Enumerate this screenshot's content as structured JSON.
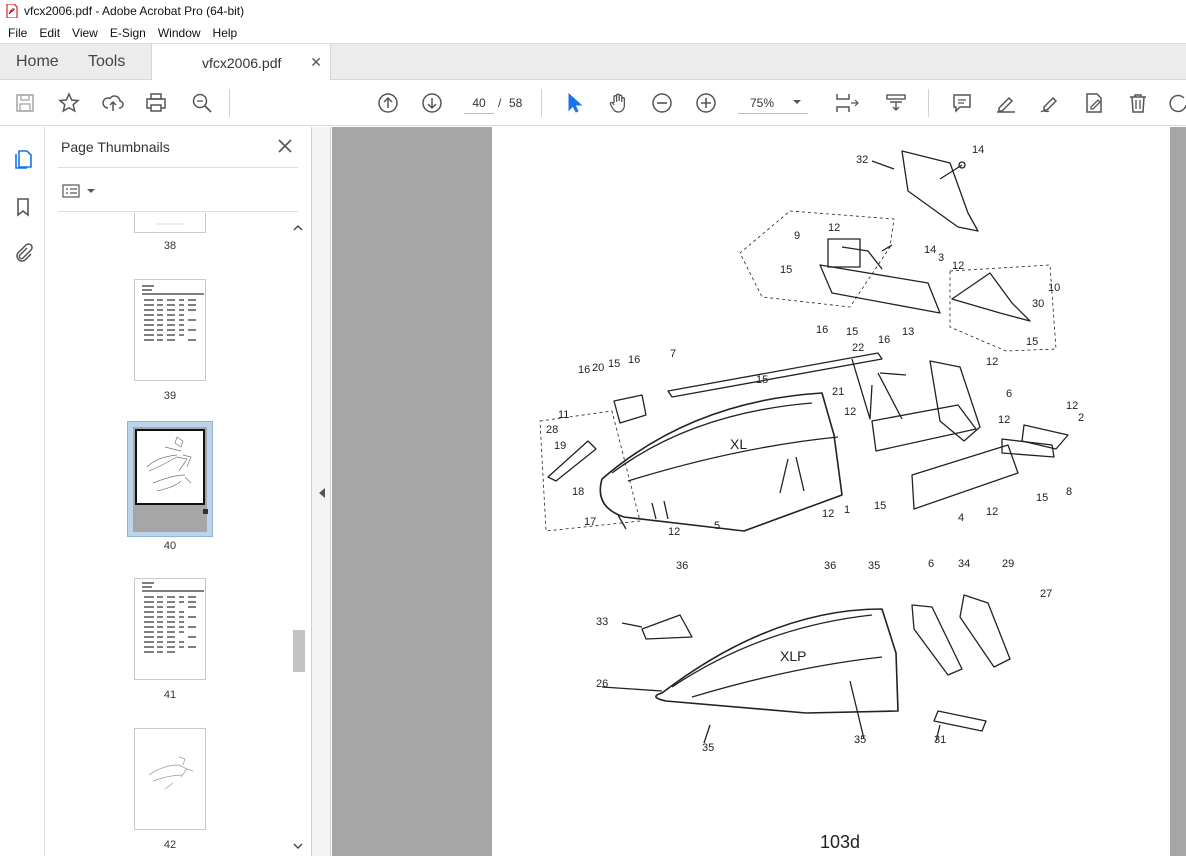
{
  "window": {
    "title": "vfcx2006.pdf - Adobe Acrobat Pro (64-bit)"
  },
  "menu": [
    "File",
    "Edit",
    "View",
    "E-Sign",
    "Window",
    "Help"
  ],
  "nav_tabs": {
    "home": "Home",
    "tools": "Tools",
    "document": "vfcx2006.pdf"
  },
  "toolbar": {
    "current_page": "40",
    "page_separator": "/",
    "total_pages": "58",
    "zoom": "75%"
  },
  "thumbnails_panel": {
    "title": "Page Thumbnails",
    "pages": [
      {
        "label": "38",
        "selected": false
      },
      {
        "label": "39",
        "selected": false
      },
      {
        "label": "40",
        "selected": true
      },
      {
        "label": "41",
        "selected": false
      },
      {
        "label": "42",
        "selected": false
      }
    ]
  },
  "document": {
    "page_number": "103d",
    "callouts": [
      "32",
      "14",
      "9",
      "12",
      "14",
      "3",
      "12",
      "15",
      "10",
      "30",
      "16",
      "15",
      "13",
      "15",
      "16",
      "22",
      "12",
      "7",
      "15",
      "21",
      "16",
      "20",
      "15",
      "16",
      "12",
      "6",
      "11",
      "12",
      "2",
      "28",
      "19",
      "XL",
      "12",
      "15",
      "8",
      "18",
      "17",
      "5",
      "12",
      "12",
      "1",
      "15",
      "4",
      "12",
      "36",
      "36",
      "35",
      "6",
      "34",
      "29",
      "27",
      "33",
      "XLP",
      "26",
      "35",
      "35",
      "31"
    ]
  }
}
